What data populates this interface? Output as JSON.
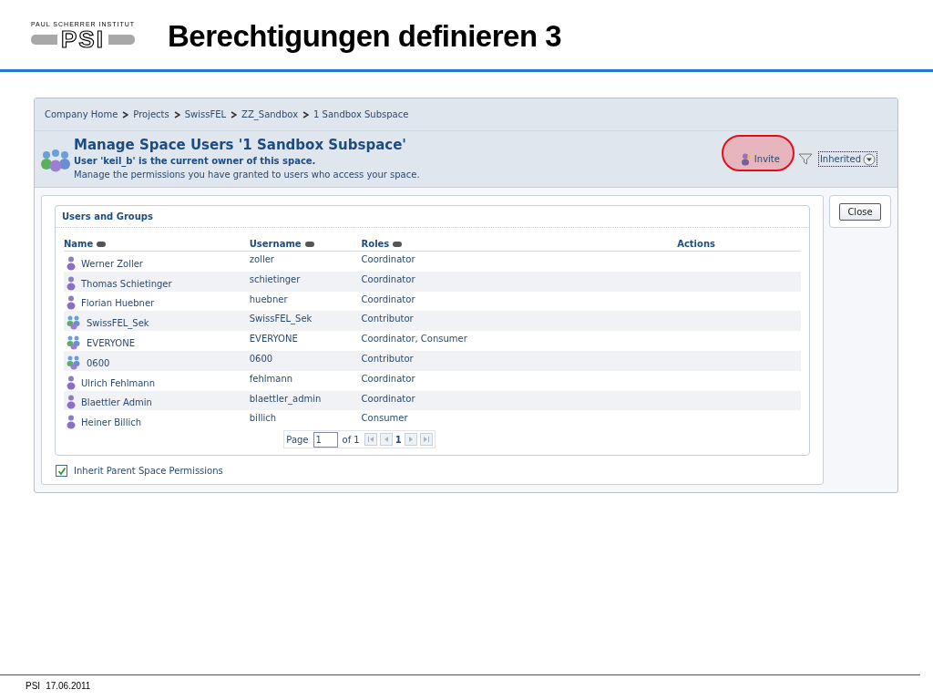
{
  "slide": {
    "logo_caption": "PAUL SCHERRER INSTITUT",
    "logo_text": "PSI",
    "title": "Berechtigungen definieren 3",
    "footer": [
      "PSI",
      "17.06.2011"
    ]
  },
  "breadcrumb": [
    "Company Home",
    "Projects",
    "SwissFEL",
    "ZZ_Sandbox",
    "1 Sandbox Subspace"
  ],
  "header": {
    "title": "Manage Space Users '1 Sandbox Subspace'",
    "owner": "User 'keil_b' is the current owner of this space.",
    "description": "Manage the permissions you have granted to users who access your space."
  },
  "invite": {
    "label": "Invite",
    "highlighted": true
  },
  "filter": {
    "value": "Inherited"
  },
  "close_button": "Close",
  "panel": {
    "title": "Users and Groups",
    "columns": [
      {
        "label": "Name",
        "sortable": true
      },
      {
        "label": "Username",
        "sortable": true
      },
      {
        "label": "Roles",
        "sortable": true
      },
      {
        "label": "Actions",
        "sortable": false
      }
    ],
    "rows": [
      {
        "kind": "user",
        "name": "Werner Zoller",
        "username": "zoller",
        "roles": "Coordinator"
      },
      {
        "kind": "user",
        "name": "Thomas Schietinger",
        "username": "schietinger",
        "roles": "Coordinator"
      },
      {
        "kind": "user",
        "name": "Florian Huebner",
        "username": "huebner",
        "roles": "Coordinator"
      },
      {
        "kind": "group",
        "name": "SwissFEL_Sek",
        "username": "SwissFEL_Sek",
        "roles": "Contributor"
      },
      {
        "kind": "group",
        "name": "EVERYONE",
        "username": "EVERYONE",
        "roles": "Coordinator, Consumer"
      },
      {
        "kind": "group",
        "name": "0600",
        "username": "0600",
        "roles": "Contributor"
      },
      {
        "kind": "user",
        "name": "Ulrich Fehlmann",
        "username": "fehlmann",
        "roles": "Coordinator"
      },
      {
        "kind": "user",
        "name": "Blaettler Admin",
        "username": "blaettler_admin",
        "roles": "Coordinator"
      },
      {
        "kind": "user",
        "name": "Heiner Billich",
        "username": "billich",
        "roles": "Consumer"
      }
    ],
    "pager": {
      "label": "Page",
      "value": "1",
      "of": "of 1",
      "current": "1"
    }
  },
  "inherit": {
    "label": "Inherit Parent Space Permissions",
    "checked": true
  }
}
